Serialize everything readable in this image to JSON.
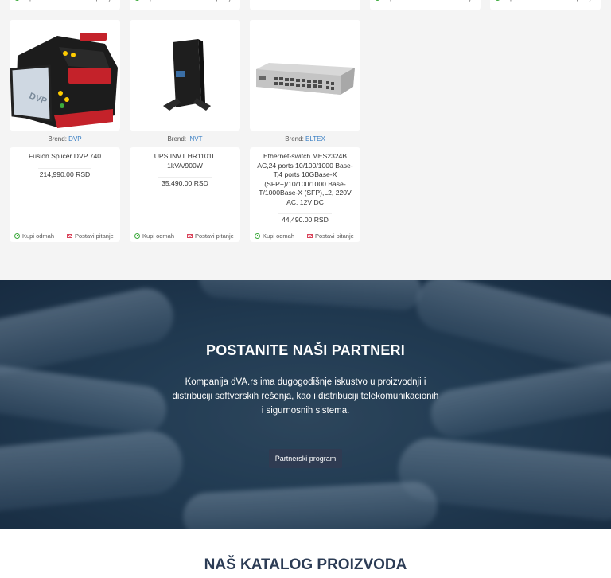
{
  "actions": {
    "buy_label": "Kupi odmah",
    "ask_label": "Postavi pitanje"
  },
  "brand_prefix": "Brend:",
  "products": [
    {
      "brand": "DVP",
      "name": "Fusion Splicer DVP 740",
      "price": "214,990.00 RSD",
      "image_icon": "fusion-splicer-image"
    },
    {
      "brand": "INVT",
      "name": "UPS INVT HR1101L 1kVA/900W",
      "price": "35,490.00 RSD",
      "image_icon": "ups-image"
    },
    {
      "brand": "ELTEX",
      "name": "Ethernet-switch MES2324B AC,24 ports 10/100/1000 Base-T,4 ports 10GBase-X (SFP+)/10/100/1000 Base-T/1000Base-X (SFP),L2, 220V AC, 12V DC",
      "price": "44,490.00 RSD",
      "image_icon": "network-switch-image"
    }
  ],
  "partners": {
    "title": "POSTANITE NAŠI PARTNERI",
    "text": "Kompanija dVA.rs ima dugogodišnje iskustvo u proizvodnji i distribuciji softverskih rešenja, kao i distribuciji telekomunikacionih i sigurnosnih sistema.",
    "button": "Partnerski program"
  },
  "catalog": {
    "title": "NAŠ KATALOG PROIZVODA"
  },
  "colors": {
    "brand_link": "#3a7fc4",
    "buy_icon": "#3caa3c",
    "ask_icon": "#d9435a",
    "partner_button": "#2f3b52",
    "catalog_title": "#2c3c55"
  }
}
